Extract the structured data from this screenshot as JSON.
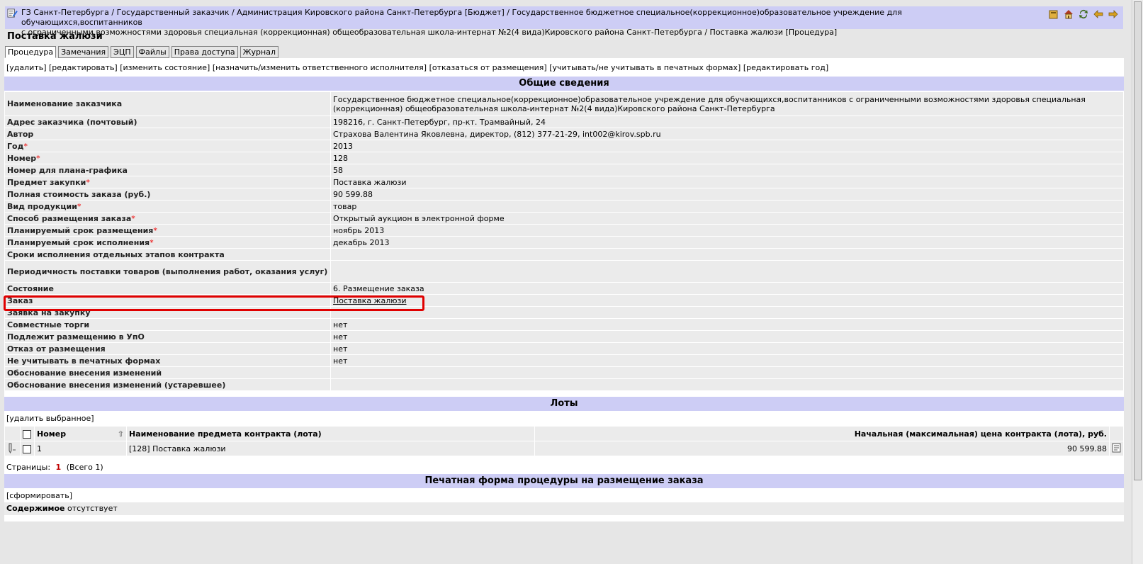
{
  "breadcrumb": {
    "line1": "ГЗ Санкт-Петербурга / Государственный заказчик / Администрация Кировского района Санкт-Петербурга [Бюджет] / Государственное бюджетное специальное(коррекционное)образовательное учреждение для обучающихся,воспитанников",
    "line2": "с ограниченными возможностями здоровья специальная (коррекционная) общеобразовательная школа-интернат №2(4 вида)Кировского района Санкт-Петербурга / Поставка жалюзи [Процедура]"
  },
  "page_title": "Поставка жалюзи",
  "tabs": [
    {
      "label": "Процедура",
      "active": true
    },
    {
      "label": "Замечания"
    },
    {
      "label": "ЭЦП"
    },
    {
      "label": "Файлы"
    },
    {
      "label": "Права доступа"
    },
    {
      "label": "Журнал"
    }
  ],
  "actions": [
    "[удалить]",
    "[редактировать]",
    "[изменить состояние]",
    "[назначить/изменить ответственного исполнителя]",
    "[отказаться от размещения]",
    "[учитывать/не учитывать в печатных формах]",
    "[редактировать год]"
  ],
  "general": {
    "heading": "Общие сведения",
    "rows": [
      {
        "label": "Наименование заказчика",
        "value": "Государственное бюджетное специальное(коррекционное)образовательное учреждение для обучающихся,воспитанников с ограниченными возможностями здоровья специальная (коррекционная) общеобразовательная школа-интернат №2(4 вида)Кировского района Санкт-Петербурга"
      },
      {
        "label": "Адрес заказчика (почтовый)",
        "value": "198216, г. Санкт-Петербург, пр-кт. Трамвайный, 24"
      },
      {
        "label": "Автор",
        "value": "Страхова Валентина Яковлевна, директор, (812) 377-21-29, int002@kirov.spb.ru"
      },
      {
        "label": "Год",
        "value": "2013",
        "required": "*"
      },
      {
        "label": "Номер",
        "value": "128",
        "required": "*"
      },
      {
        "label": "Номер для плана-графика",
        "value": "58"
      },
      {
        "label": "Предмет закупки",
        "value": "Поставка жалюзи",
        "required": "*"
      },
      {
        "label": "Полная стоимость заказа (руб.)",
        "value": "90 599.88"
      },
      {
        "label": "Вид продукции",
        "value": "товар",
        "required": "*"
      },
      {
        "label": "Способ размещения заказа",
        "value": "Открытый аукцион в электронной форме",
        "required": "*"
      },
      {
        "label": "Планируемый срок размещения",
        "value": "ноябрь 2013",
        "required": "*"
      },
      {
        "label": "Планируемый срок исполнения",
        "value": "декабрь 2013",
        "required": "*"
      },
      {
        "label": "Сроки исполнения отдельных этапов контракта",
        "value": ""
      },
      {
        "label": "Периодичность поставки товаров (выполнения работ, оказания услуг)",
        "value": ""
      },
      {
        "label": "Состояние",
        "value": "6. Размещение заказа"
      },
      {
        "label": "Заказ",
        "value": "Поставка жалюзи",
        "link": true
      },
      {
        "label": "Заявка на закупку",
        "value": ""
      },
      {
        "label": "Совместные торги",
        "value": "нет"
      },
      {
        "label": "Подлежит размещению в УпО",
        "value": "нет"
      },
      {
        "label": "Отказ от размещения",
        "value": "нет"
      },
      {
        "label": "Не учитывать в печатных формах",
        "value": "нет"
      },
      {
        "label": "Обоснование внесения изменений",
        "value": ""
      },
      {
        "label": "Обоснование внесения изменений (устаревшее)",
        "value": ""
      }
    ]
  },
  "lots": {
    "heading": "Лоты",
    "delete_selected": "[удалить выбранное]",
    "columns": {
      "number": "Номер",
      "name": "Наименование предмета контракта (лота)",
      "price": "Начальная (максимальная) цена контракта (лота), руб."
    },
    "rows": [
      {
        "number": "1",
        "name": "[128] Поставка жалюзи",
        "price": "90 599.88"
      }
    ],
    "pager_label": "Страницы:",
    "pager_current": "1",
    "pager_total": "(Всего 1)"
  },
  "print_form": {
    "heading": "Печатная форма процедуры на размещение заказа",
    "generate": "[сформировать]",
    "content_label": "Содержимое",
    "content_value": "отсутствует"
  },
  "colors": {
    "header_bg": "#cdcdf5",
    "row_bg": "#ebebeb",
    "required": "#ee0000",
    "highlight": "#e00000"
  }
}
